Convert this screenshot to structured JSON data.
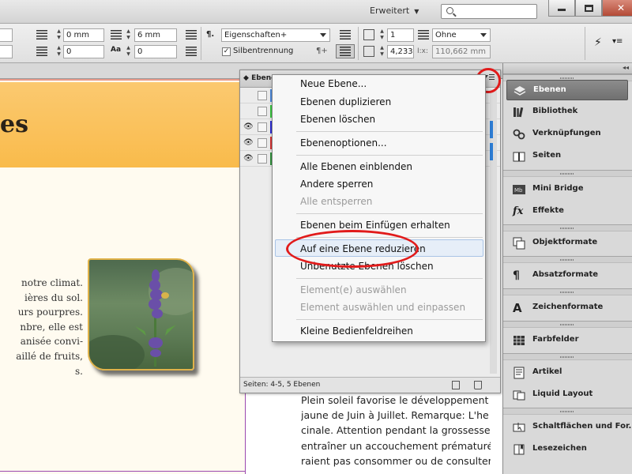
{
  "titlebar": {
    "workspace": "Erweitert",
    "search_placeholder": "",
    "buttons": {
      "minimize": "",
      "maximize": "",
      "close": "✕"
    }
  },
  "control": {
    "indent_left_top": "0 mm",
    "indent_left_bottom": "0",
    "space_before": "0 mm",
    "space_after": "6 mm",
    "drop_cap_lines": "0",
    "indent_right": "0",
    "paragraph_style": "Eigenschaften+",
    "hyphenation_label": "Silbentrennung",
    "hyphenation_checked": true,
    "columns": "1",
    "column_width": "4,233 r",
    "span_columns": "Ohne",
    "total_width": "110,662 mm"
  },
  "document": {
    "heading_fragment": "es",
    "left_text": [
      "notre climat.",
      "ières du sol.",
      "urs pourpres.",
      "nbre, elle est",
      "anisée convi-",
      "aillé de fruits,",
      "s."
    ],
    "right_text": [
      "Plein soleil favorise le développement",
      "jaune de Juin à Juillet. Remarque: L'he",
      "cinale. Attention pendant la grossesse",
      "entraîner un accouchement prématuré",
      "raient pas consommer ou de consulter"
    ]
  },
  "layers_panel": {
    "tab": "Ebenen",
    "rows": [
      {
        "visible": false,
        "color": "#4a86d8"
      },
      {
        "visible": false,
        "color": "#36c23e"
      },
      {
        "visible": true,
        "color": "#2b2bd1"
      },
      {
        "visible": true,
        "color": "#d23030"
      },
      {
        "visible": true,
        "color": "#2f8f3a"
      }
    ],
    "status": "Seiten: 4-5, 5 Ebenen"
  },
  "menu": {
    "items": [
      {
        "label": "Neue Ebene...",
        "disabled": false
      },
      {
        "label": "Ebenen duplizieren",
        "disabled": false
      },
      {
        "label": "Ebenen löschen",
        "disabled": false
      },
      {
        "label": "Ebenenoptionen...",
        "disabled": false
      },
      {
        "label": "Alle Ebenen einblenden",
        "disabled": false
      },
      {
        "label": "Andere sperren",
        "disabled": false
      },
      {
        "label": "Alle entsperren",
        "disabled": true
      },
      {
        "label": "Ebenen beim Einfügen erhalten",
        "disabled": false
      },
      {
        "label": "Auf eine Ebene reduzieren",
        "disabled": false,
        "highlighted": true
      },
      {
        "label": "Unbenutzte Ebenen löschen",
        "disabled": false
      },
      {
        "label": "Element(e) auswählen",
        "disabled": true
      },
      {
        "label": "Element auswählen und einpassen",
        "disabled": true
      },
      {
        "label": "Kleine Bedienfeldreihen",
        "disabled": false
      }
    ]
  },
  "dock": {
    "collapse": "◂◂",
    "items": [
      {
        "label": "Ebenen",
        "icon": "layers-icon",
        "active": true
      },
      {
        "label": "Bibliothek",
        "icon": "library-icon"
      },
      {
        "label": "Verknüpfungen",
        "icon": "links-icon"
      },
      {
        "label": "Seiten",
        "icon": "pages-icon"
      },
      {
        "label": "Mini Bridge",
        "icon": "mini-bridge-icon"
      },
      {
        "label": "Effekte",
        "icon": "effects-icon"
      },
      {
        "label": "Objektformate",
        "icon": "object-styles-icon"
      },
      {
        "label": "Absatzformate",
        "icon": "paragraph-styles-icon"
      },
      {
        "label": "Zeichenformate",
        "icon": "character-styles-icon"
      },
      {
        "label": "Farbfelder",
        "icon": "swatches-icon"
      },
      {
        "label": "Artikel",
        "icon": "articles-icon"
      },
      {
        "label": "Liquid Layout",
        "icon": "liquid-layout-icon"
      },
      {
        "label": "Schaltflächen und For...",
        "icon": "buttons-forms-icon"
      },
      {
        "label": "Lesezeichen",
        "icon": "bookmarks-icon"
      }
    ]
  }
}
